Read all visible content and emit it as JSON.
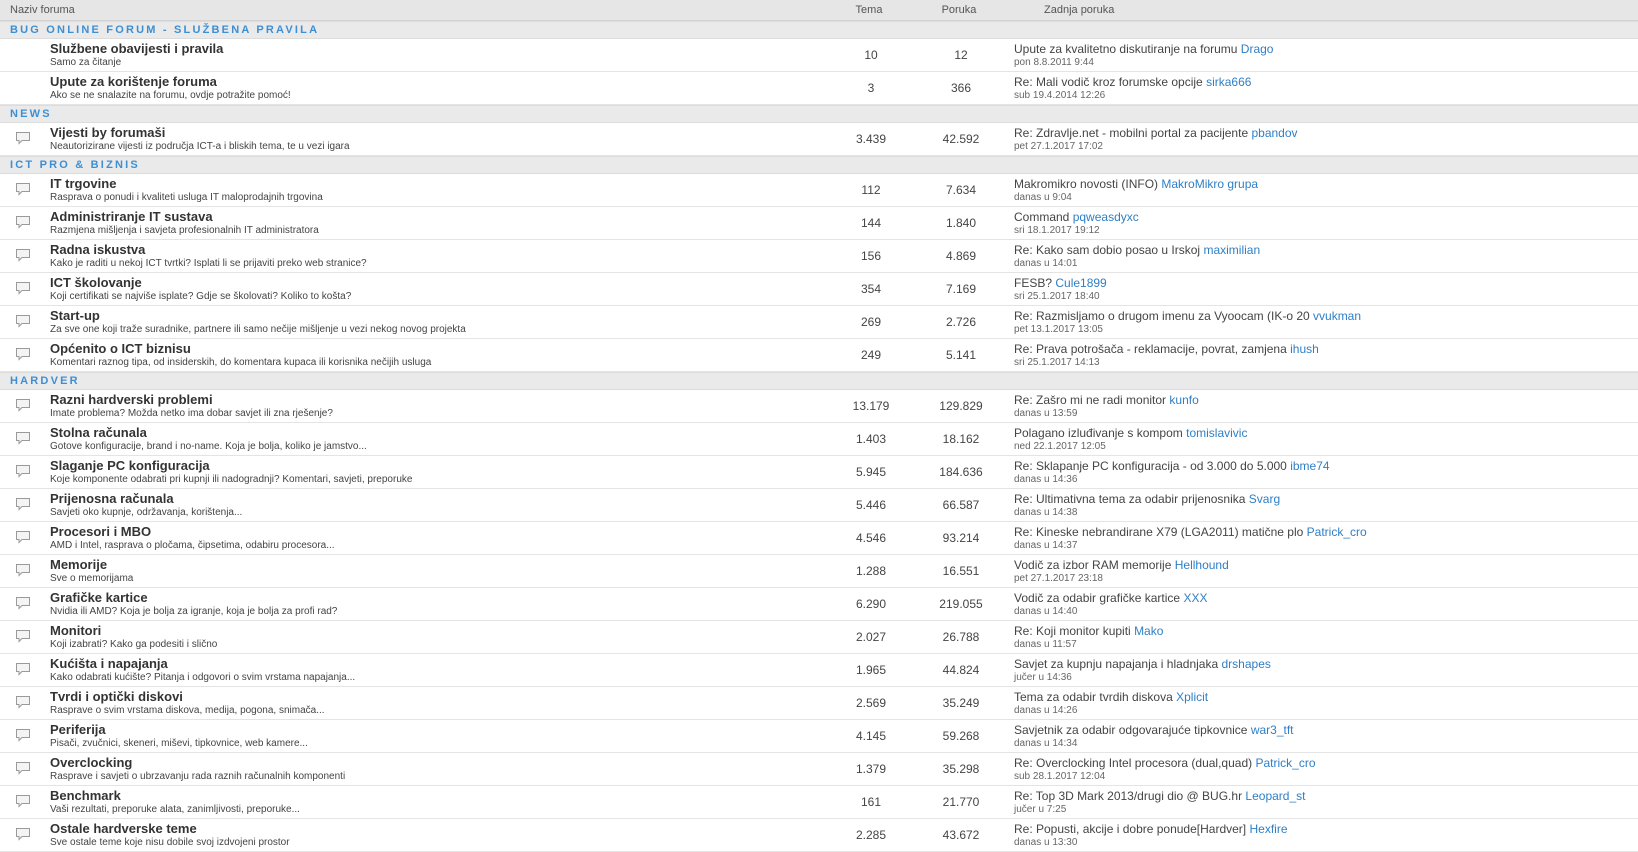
{
  "header": {
    "name": "Naziv foruma",
    "topics": "Tema",
    "posts": "Poruka",
    "last": "Zadnja poruka"
  },
  "colors": {
    "link": "#2f7fc6",
    "category": "#3d8fd4",
    "header_bg": "#e6e6e6"
  },
  "categories": [
    {
      "title": "BUG ONLINE FORUM - SLUŽBENA PRAVILA",
      "forums": [
        {
          "icon": "none",
          "name": "Službene obavijesti i pravila",
          "desc": "Samo za čitanje",
          "topics": "10",
          "posts": "12",
          "last_title": "Upute za kvalitetno diskutiranje na forumu",
          "last_user": "Drago",
          "last_date": "pon 8.8.2011 9:44"
        },
        {
          "icon": "none",
          "name": "Upute za korištenje foruma",
          "desc": "Ako se ne snalazite na forumu, ovdje potražite pomoć!",
          "topics": "3",
          "posts": "366",
          "last_title": "Re: Mali vodič kroz forumske opcije",
          "last_user": "sirka666",
          "last_date": "sub 19.4.2014 12:26"
        }
      ]
    },
    {
      "title": "NEWS",
      "forums": [
        {
          "icon": "speech-bubble-icon",
          "name": "Vijesti by forumaši",
          "desc": "Neautorizirane vijesti iz područja ICT-a i bliskih tema, te u vezi igara",
          "topics": "3.439",
          "posts": "42.592",
          "last_title": "Re: Zdravlje.net - mobilni portal za pacijente",
          "last_user": "pbandov",
          "last_date": "pet 27.1.2017 17:02"
        }
      ]
    },
    {
      "title": "ICT PRO & BIZNIS",
      "forums": [
        {
          "icon": "speech-bubble-icon",
          "name": "IT trgovine",
          "desc": "Rasprava o ponudi i kvaliteti usluga IT maloprodajnih trgovina",
          "topics": "112",
          "posts": "7.634",
          "last_title": "Makromikro novosti (INFO)",
          "last_user": "MakroMikro grupa",
          "last_date": "danas u 9:04"
        },
        {
          "icon": "speech-bubble-icon",
          "name": "Administriranje IT sustava",
          "desc": "Razmjena mišljenja i savjeta profesionalnih IT administratora",
          "topics": "144",
          "posts": "1.840",
          "last_title": "Command",
          "last_user": "pqweasdyxc",
          "last_date": "sri 18.1.2017 19:12"
        },
        {
          "icon": "speech-bubble-icon",
          "name": "Radna iskustva",
          "desc": "Kako je raditi u nekoj ICT tvrtki? Isplati li se prijaviti preko web stranice?",
          "topics": "156",
          "posts": "4.869",
          "last_title": "Re: Kako sam dobio posao u Irskoj",
          "last_user": "maximilian",
          "last_date": "danas u 14:01"
        },
        {
          "icon": "speech-bubble-icon",
          "name": "ICT školovanje",
          "desc": "Koji certifikati se najviše isplate? Gdje se školovati? Koliko to košta?",
          "topics": "354",
          "posts": "7.169",
          "last_title": "FESB?",
          "last_user": "Cule1899",
          "last_date": "sri 25.1.2017 18:40"
        },
        {
          "icon": "speech-bubble-icon",
          "name": "Start-up",
          "desc": "Za sve one koji traže suradnike, partnere ili samo nečije mišljenje u vezi nekog novog projekta",
          "topics": "269",
          "posts": "2.726",
          "last_title": "Re: Razmisljamo o drugom imenu za Vyoocam (IK-o 20",
          "last_user": "vvukman",
          "last_date": "pet 13.1.2017 13:05"
        },
        {
          "icon": "speech-bubble-icon",
          "name": "Općenito o ICT biznisu",
          "desc": "Komentari raznog tipa, od insiderskih, do komentara kupaca ili korisnika nečijih usluga",
          "topics": "249",
          "posts": "5.141",
          "last_title": "Re: Prava potrošača - reklamacije, povrat, zamjena",
          "last_user": "ihush",
          "last_date": "sri 25.1.2017 14:13"
        }
      ]
    },
    {
      "title": "HARDVER",
      "forums": [
        {
          "icon": "speech-bubble-icon",
          "name": "Razni hardverski problemi",
          "desc": "Imate problema? Možda netko ima dobar savjet ili zna rješenje?",
          "topics": "13.179",
          "posts": "129.829",
          "last_title": "Re: Zašro mi ne radi monitor",
          "last_user": "kunfo",
          "last_date": "danas u 13:59"
        },
        {
          "icon": "speech-bubble-icon",
          "name": "Stolna računala",
          "desc": "Gotove konfiguracije, brand i no-name. Koja je bolja, koliko je jamstvo...",
          "topics": "1.403",
          "posts": "18.162",
          "last_title": "Polagano izluđivanje s kompom",
          "last_user": "tomislavivic",
          "last_date": "ned 22.1.2017 12:05"
        },
        {
          "icon": "speech-bubble-icon",
          "name": "Slaganje PC konfiguracija",
          "desc": "Koje komponente odabrati pri kupnji ili nadogradnji? Komentari, savjeti, preporuke",
          "topics": "5.945",
          "posts": "184.636",
          "last_title": "Re: Sklapanje PC konfiguracija - od 3.000 do 5.000",
          "last_user": "ibme74",
          "last_date": "danas u 14:36"
        },
        {
          "icon": "speech-bubble-icon",
          "name": "Prijenosna računala",
          "desc": "Savjeti oko kupnje, održavanja, korištenja...",
          "topics": "5.446",
          "posts": "66.587",
          "last_title": "Re: Ultimativna tema za odabir prijenosnika",
          "last_user": "Svarg",
          "last_date": "danas u 14:38"
        },
        {
          "icon": "speech-bubble-icon",
          "name": "Procesori i MBO",
          "desc": "AMD i Intel, rasprava o pločama, čipsetima, odabiru procesora...",
          "topics": "4.546",
          "posts": "93.214",
          "last_title": "Re: Kineske nebrandirane X79 (LGA2011) matične plo",
          "last_user": "Patrick_cro",
          "last_date": "danas u 14:37"
        },
        {
          "icon": "speech-bubble-icon",
          "name": "Memorije",
          "desc": "Sve o memorijama",
          "topics": "1.288",
          "posts": "16.551",
          "last_title": "Vodič za izbor RAM memorije",
          "last_user": "Hellhound",
          "last_date": "pet 27.1.2017 23:18"
        },
        {
          "icon": "speech-bubble-icon",
          "name": "Grafičke kartice",
          "desc": "Nvidia ili AMD? Koja je bolja za igranje, koja je bolja za profi rad?",
          "topics": "6.290",
          "posts": "219.055",
          "last_title": "Vodič za odabir grafičke kartice",
          "last_user": "XXX",
          "last_date": "danas u 14:40"
        },
        {
          "icon": "speech-bubble-icon",
          "name": "Monitori",
          "desc": "Koji izabrati? Kako ga podesiti i slično",
          "topics": "2.027",
          "posts": "26.788",
          "last_title": "Re: Koji monitor kupiti",
          "last_user": "Mako",
          "last_date": "danas u 11:57"
        },
        {
          "icon": "speech-bubble-icon",
          "name": "Kućišta i napajanja",
          "desc": "Kako odabrati kućište? Pitanja i odgovori o svim vrstama napajanja...",
          "topics": "1.965",
          "posts": "44.824",
          "last_title": "Savjet za kupnju napajanja i hladnjaka",
          "last_user": "drshapes",
          "last_date": "jučer u 14:36"
        },
        {
          "icon": "speech-bubble-icon",
          "name": "Tvrdi i optički diskovi",
          "desc": "Rasprave o svim vrstama diskova, medija, pogona, snimača...",
          "topics": "2.569",
          "posts": "35.249",
          "last_title": "Tema za odabir tvrdih diskova",
          "last_user": "Xplicit",
          "last_date": "danas u 14:26"
        },
        {
          "icon": "speech-bubble-icon",
          "name": "Periferija",
          "desc": "Pisači, zvučnici, skeneri, miševi, tipkovnice, web kamere...",
          "topics": "4.145",
          "posts": "59.268",
          "last_title": "Savjetnik za odabir odgovarajuće tipkovnice",
          "last_user": "war3_tft",
          "last_date": "danas u 14:34"
        },
        {
          "icon": "speech-bubble-icon",
          "name": "Overclocking",
          "desc": "Rasprave i savjeti o ubrzavanju rada raznih računalnih komponenti",
          "topics": "1.379",
          "posts": "35.298",
          "last_title": "Re: Overclocking Intel procesora (dual,quad)",
          "last_user": "Patrick_cro",
          "last_date": "sub 28.1.2017 12:04"
        },
        {
          "icon": "speech-bubble-icon",
          "name": "Benchmark",
          "desc": "Vaši rezultati, preporuke alata, zanimljivosti, preporuke...",
          "topics": "161",
          "posts": "21.770",
          "last_title": "Re: Top 3D Mark 2013/drugi dio @ BUG.hr",
          "last_user": "Leopard_st",
          "last_date": "jučer u 7:25"
        },
        {
          "icon": "speech-bubble-icon",
          "name": "Ostale hardverske teme",
          "desc": "Sve ostale teme koje nisu dobile svoj izdvojeni prostor",
          "topics": "2.285",
          "posts": "43.672",
          "last_title": "Re: Popusti, akcije i dobre ponude[Hardver]",
          "last_user": "Hexfire",
          "last_date": "danas u 13:30"
        }
      ]
    }
  ]
}
